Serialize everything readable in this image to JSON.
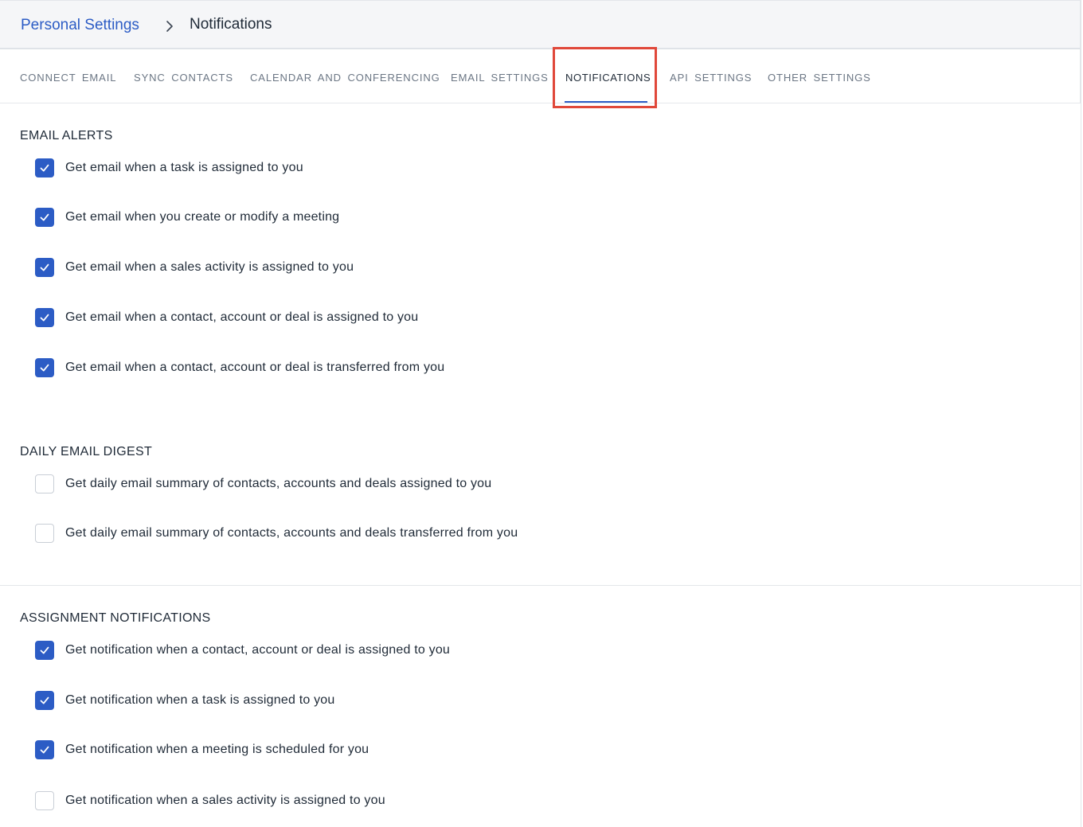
{
  "breadcrumb": {
    "parent": "Personal Settings",
    "current": "Notifications"
  },
  "tabs": [
    {
      "label": "Connect Email",
      "active": false
    },
    {
      "label": "Sync Contacts",
      "active": false
    },
    {
      "label": "Calendar and Conferencing",
      "active": false
    },
    {
      "label": "Email Settings",
      "active": false
    },
    {
      "label": "Notifications",
      "active": true
    },
    {
      "label": "API Settings",
      "active": false
    },
    {
      "label": "Other Settings",
      "active": false
    }
  ],
  "sections": {
    "email_alerts": {
      "title": "Email Alerts",
      "options": [
        {
          "label": "Get email when a task is assigned to you",
          "checked": true
        },
        {
          "label": "Get email when you create or modify a meeting",
          "checked": true
        },
        {
          "label": "Get email when a sales activity is assigned to you",
          "checked": true
        },
        {
          "label": "Get email when a contact, account or deal is assigned to you",
          "checked": true
        },
        {
          "label": "Get email when a contact, account or deal is transferred from you",
          "checked": true
        }
      ]
    },
    "daily_digest": {
      "title": "Daily Email Digest",
      "options": [
        {
          "label": "Get daily email summary of contacts, accounts and deals assigned to you",
          "checked": false
        },
        {
          "label": "Get daily email summary of contacts, accounts and deals transferred from you",
          "checked": false
        }
      ]
    },
    "assignment_notifications": {
      "title": "Assignment Notifications",
      "options": [
        {
          "label": "Get notification when a contact, account or deal is assigned to you",
          "checked": true
        },
        {
          "label": "Get notification when a task is assigned to you",
          "checked": true
        },
        {
          "label": "Get notification when a meeting is scheduled for you",
          "checked": true
        },
        {
          "label": "Get notification when a sales activity is assigned to you",
          "checked": false
        }
      ]
    }
  },
  "colors": {
    "accent": "#2c5cc5",
    "highlight": "#e0483a"
  }
}
